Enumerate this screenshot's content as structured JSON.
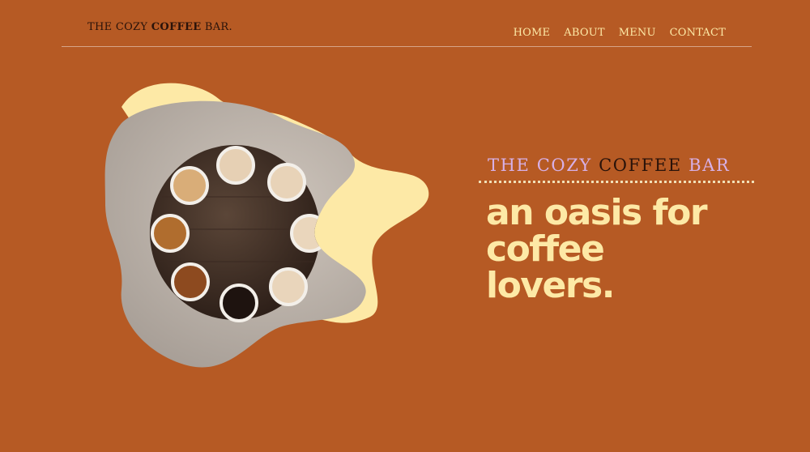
{
  "header": {
    "logo": {
      "part1": "THE COZY ",
      "part2": "COFFEE",
      "part3": " BAR."
    },
    "nav": [
      "HOME",
      "ABOUT",
      "MENU",
      "CONTACT"
    ]
  },
  "hero": {
    "eyebrow": {
      "part1": "THE COZY ",
      "part2": "COFFEE",
      "part3": " BAR"
    },
    "headline_lines": [
      "an oasis for",
      "coffee",
      "lovers."
    ],
    "image": "overhead-coffee-cups-on-round-table"
  },
  "colors": {
    "background": "#b65a24",
    "cream": "#fde9a6",
    "lavender": "#d7b0e6",
    "dark_brown": "#2a130a"
  }
}
